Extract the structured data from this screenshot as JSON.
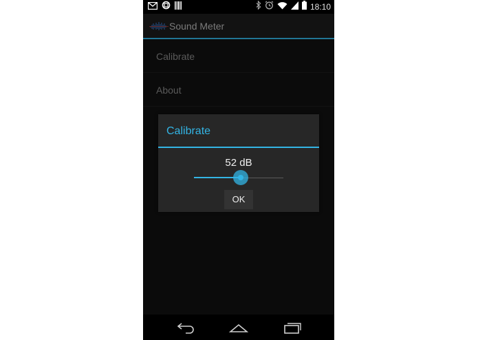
{
  "status_bar": {
    "time": "18:10",
    "left_icons": [
      "gmail-icon",
      "circle-app-icon",
      "barcode-icon"
    ],
    "right_icons": [
      "bluetooth-icon",
      "alarm-icon",
      "wifi-icon",
      "signal-icon",
      "battery-icon"
    ]
  },
  "action_bar": {
    "title": "Sound Meter",
    "icon": "sound-meter-logo-icon"
  },
  "menu": {
    "items": [
      {
        "label": "Calibrate"
      },
      {
        "label": "About"
      }
    ]
  },
  "dialog": {
    "title": "Calibrate",
    "value_label": "52 dB",
    "slider_fraction": 0.52,
    "ok_label": "OK"
  },
  "nav_bar": {
    "icons": [
      "back-icon",
      "home-icon",
      "recent-apps-icon"
    ]
  },
  "colors": {
    "accent": "#33b5e5",
    "background": "#111111",
    "dialog_bg": "#272727"
  }
}
